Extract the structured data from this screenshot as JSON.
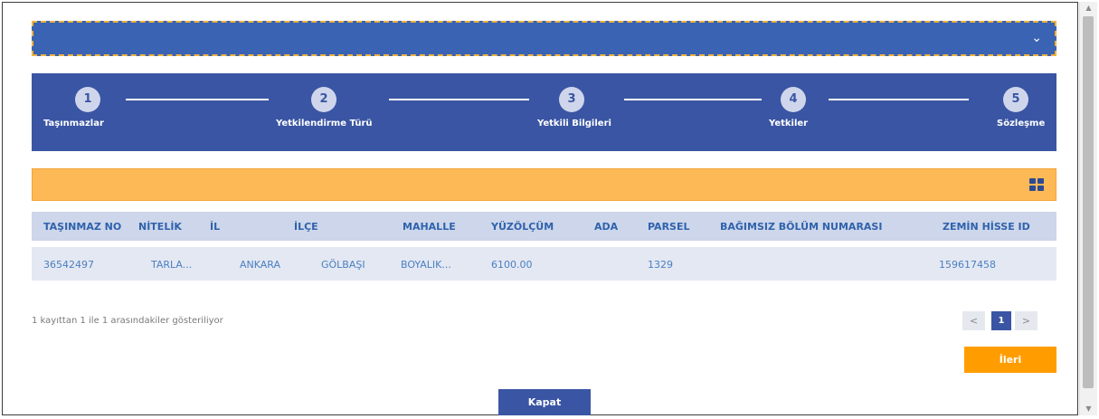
{
  "stepper": {
    "steps": [
      {
        "number": "1",
        "label": "Taşınmazlar"
      },
      {
        "number": "2",
        "label": "Yetkilendirme Türü"
      },
      {
        "number": "3",
        "label": "Yetkili Bilgileri"
      },
      {
        "number": "4",
        "label": "Yetkiler"
      },
      {
        "number": "5",
        "label": "Sözleşme"
      }
    ]
  },
  "table": {
    "columns": [
      "TAŞINMAZ NO",
      "NİTELİK",
      "İL",
      "İLÇE",
      "MAHALLE",
      "YÜZÖLÇÜM",
      "ADA",
      "PARSEL",
      "BAĞIMSIZ BÖLÜM NUMARASI",
      "ZEMİN HİSSE ID"
    ],
    "rows": [
      [
        "36542497",
        "TARLA...",
        "ANKARA",
        "GÖLBAŞI",
        "BOYALIK...",
        "6100.00",
        "",
        "1329",
        "",
        "159617458"
      ]
    ]
  },
  "pagination": {
    "info": "1 kayıttan 1 ile 1 arasındakiler gösteriliyor",
    "prev": "<",
    "current_page": "1",
    "next": ">"
  },
  "buttons": {
    "next_label": "İleri",
    "close_label": "Kapat"
  },
  "icons": {
    "collapse": "chevron-down-icon",
    "view": "grid-view-icon"
  },
  "colors": {
    "primary": "#3a55a3",
    "accent": "#ff9d00",
    "warning_bar": "#fdb955"
  }
}
